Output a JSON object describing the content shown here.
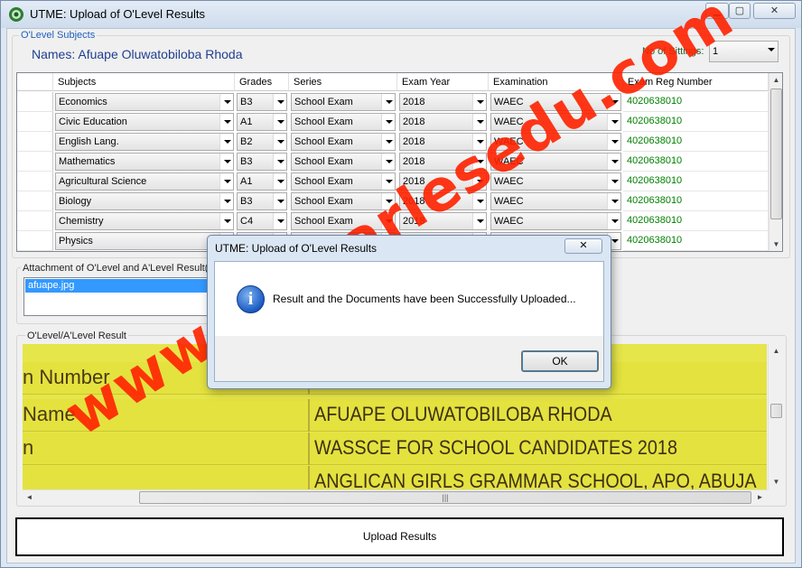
{
  "window": {
    "title": "UTME: Upload of O'Level Results",
    "icon": "app-logo-icon"
  },
  "olevel": {
    "group_label": "O'Level Subjects",
    "names_label": "Names: Afuape Oluwatobiloba Rhoda",
    "sittings_label": "No of Sittings:",
    "sittings_value": "1",
    "columns": [
      "Subjects",
      "Grades",
      "Series",
      "Exam Year",
      "Examination",
      "Exam Reg Number"
    ],
    "rows": [
      {
        "subject": "Economics",
        "grade": "B3",
        "series": "School Exam",
        "year": "2018",
        "exam": "WAEC",
        "reg": "4020638010"
      },
      {
        "subject": "Civic Education",
        "grade": "A1",
        "series": "School Exam",
        "year": "2018",
        "exam": "WAEC",
        "reg": "4020638010"
      },
      {
        "subject": "English Lang.",
        "grade": "B2",
        "series": "School Exam",
        "year": "2018",
        "exam": "WAEC",
        "reg": "4020638010"
      },
      {
        "subject": "Mathematics",
        "grade": "B3",
        "series": "School Exam",
        "year": "2018",
        "exam": "WAEC",
        "reg": "4020638010"
      },
      {
        "subject": "Agricultural Science",
        "grade": "A1",
        "series": "School Exam",
        "year": "2018",
        "exam": "WAEC",
        "reg": "4020638010"
      },
      {
        "subject": "Biology",
        "grade": "B3",
        "series": "School Exam",
        "year": "2018",
        "exam": "WAEC",
        "reg": "4020638010"
      },
      {
        "subject": "Chemistry",
        "grade": "C4",
        "series": "School Exam",
        "year": "2018",
        "exam": "WAEC",
        "reg": "4020638010"
      },
      {
        "subject": "Physics",
        "grade": "",
        "series": "",
        "year": "",
        "exam": "",
        "reg": "4020638010"
      }
    ]
  },
  "attachment": {
    "group_label": "Attachment of O'Level and A'Level Result(s",
    "files": [
      "afuape.jpg"
    ]
  },
  "result_view": {
    "group_label": "O'Level/A'Level Result",
    "rows": [
      {
        "left": "n Number",
        "right": ""
      },
      {
        "left": "Name",
        "right": "AFUAPE OLUWATOBILOBA RHODA"
      },
      {
        "left": "n",
        "right": "WASSCE FOR SCHOOL CANDIDATES 2018"
      },
      {
        "left": "",
        "right": "ANGLICAN GIRLS GRAMMAR SCHOOL, APO, ABUJA"
      }
    ]
  },
  "upload_button_label": "Upload Results",
  "dialog": {
    "title": "UTME: Upload of O'Level Results",
    "close_label": "✕",
    "message": "Result and the Documents have been Successfully Uploaded...",
    "ok_label": "OK"
  },
  "watermark": "www.stcharlesedu.com",
  "colors": {
    "reg_number_green": "#008000",
    "names_blue": "#1f3f8f",
    "watermark_red": "#ff2200",
    "selection_blue": "#3399ff",
    "result_yellow": "#e4e23f"
  }
}
